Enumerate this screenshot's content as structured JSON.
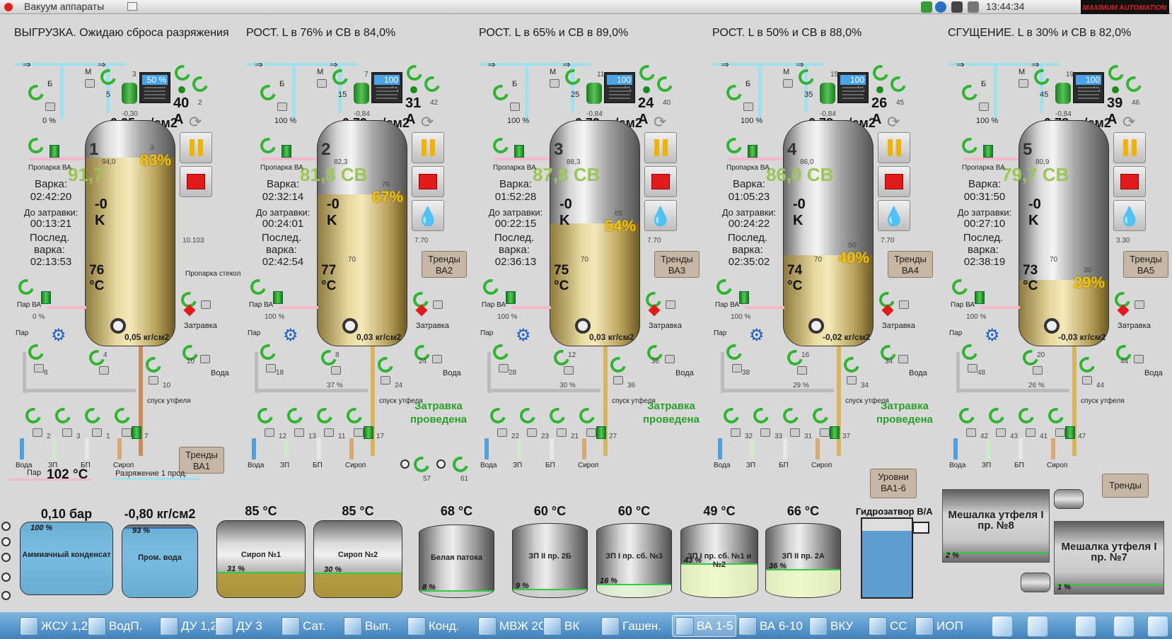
{
  "window": {
    "title": "Вакуум аппараты",
    "clock": "13:44:34",
    "brand": "MAXIMUM AUTOMATION"
  },
  "units": [
    {
      "header": "ВЫГРУЗКА. Ожидаю сброса разряжения",
      "num": "1",
      "monitor_pct": "50 %",
      "monitor_id": "3",
      "amps": "40 A",
      "amps_small": "2",
      "pressure_small": "-0,30",
      "pressure": "-0,35 кг/см2",
      "level_set": "94,0",
      "cb": "91,7",
      "cb_unit": "",
      "level_pct": "83%",
      "level_small": "3",
      "fill": 0.83,
      "varka_label": "Варка:",
      "varka": "02:42:20",
      "k": "-0 K",
      "zatravka_label": "До затравки:",
      "zatravka": "00:13:21",
      "last_label": "Послед. варка:",
      "last": "02:13:53",
      "temp": "76 °C",
      "temp_small": "",
      "bottom_press": "0,05 кг/см2",
      "flow": "",
      "trend": "Тренды ВА1",
      "cond_pct": "0 %",
      "steam_pct": "0 %",
      "small_val": "10.103",
      "valve_a": "4",
      "valve_b": "10",
      "valve_c": "8",
      "valve_d": "2",
      "valve_e": "3",
      "valve_f": "1",
      "valve_g": "7",
      "left_pct": "0 %",
      "extra": "Пропарка стекол",
      "status": "",
      "purge_small": "5",
      "purge_id": "1"
    },
    {
      "header": "РОСТ. L в 76% и СВ в 84,0%",
      "num": "2",
      "monitor_pct": "100 %",
      "monitor_id": "7",
      "amps": "31 A",
      "amps_small": "42",
      "pressure_small": "-0,84",
      "pressure": "-0,79 кг/см2",
      "level_set": "82,3",
      "cb": "81,8",
      "cb_unit": "СВ",
      "level_pct": "67%",
      "level_small": "76",
      "fill": 0.67,
      "varka_label": "Варка:",
      "varka": "02:32:14",
      "k": "-0 K",
      "zatravka_label": "До затравки:",
      "zatravka": "00:24:01",
      "last_label": "Послед. варка:",
      "last": "02:42:54",
      "temp": "77 °C",
      "temp_small": "70",
      "bottom_press": "0,03 кг/см2",
      "flow": "37 %",
      "trend": "Тренды ВА2",
      "cond_pct": "100 %",
      "steam_pct": "100 %",
      "small_val": "7.70",
      "valve_a": "8",
      "valve_b": "24",
      "valve_c": "18",
      "valve_d": "12",
      "valve_e": "13",
      "valve_f": "11",
      "valve_g": "17",
      "left_pct": "100 %",
      "extra": "",
      "status": "Затравка проведена",
      "purge_small": "15",
      "purge_id": "5"
    },
    {
      "header": "РОСТ. L в 65% и СВ в 89,0%",
      "num": "3",
      "monitor_pct": "100 %",
      "monitor_id": "11",
      "amps": "24 A",
      "amps_small": "40",
      "pressure_small": "-0,84",
      "pressure": "-0,79 кг/см2",
      "level_set": "88,3",
      "cb": "87,8",
      "cb_unit": "СВ",
      "level_pct": "54%",
      "level_small": "65",
      "fill": 0.54,
      "varka_label": "Варка:",
      "varka": "01:52:28",
      "k": "-0 K",
      "zatravka_label": "До затравки:",
      "zatravka": "00:22:15",
      "last_label": "Послед. варка:",
      "last": "02:36:13",
      "temp": "75 °C",
      "temp_small": "70",
      "bottom_press": "0,03 кг/см2",
      "flow": "30 %",
      "trend": "Тренды ВА3",
      "cond_pct": "100 %",
      "steam_pct": "100 %",
      "small_val": "7.70",
      "valve_a": "12",
      "valve_b": "36",
      "valve_c": "28",
      "valve_d": "22",
      "valve_e": "23",
      "valve_f": "21",
      "valve_g": "27",
      "left_pct": "100 %",
      "extra": "",
      "status": "Затравка проведена",
      "purge_small": "25",
      "purge_id": "9"
    },
    {
      "header": "РОСТ. L в 50% и СВ в 88,0%",
      "num": "4",
      "monitor_pct": "100 %",
      "monitor_id": "15",
      "amps": "26 A",
      "amps_small": "45",
      "pressure_small": "-0,84",
      "pressure": "-0,78 кг/см2",
      "level_set": "86,0",
      "cb": "86,0",
      "cb_unit": "СВ",
      "level_pct": "40%",
      "level_small": "50",
      "fill": 0.4,
      "varka_label": "Варка:",
      "varka": "01:05:23",
      "k": "-0 K",
      "zatravka_label": "До затравки:",
      "zatravka": "00:24:22",
      "last_label": "Послед. варка:",
      "last": "02:35:02",
      "temp": "74 °C",
      "temp_small": "70",
      "bottom_press": "-0,02 кг/см2",
      "flow": "29 %",
      "trend": "Тренды ВА4",
      "cond_pct": "100 %",
      "steam_pct": "100 %",
      "small_val": "7.70",
      "valve_a": "16",
      "valve_b": "34",
      "valve_c": "38",
      "valve_d": "32",
      "valve_e": "33",
      "valve_f": "31",
      "valve_g": "37",
      "left_pct": "100 %",
      "extra": "",
      "status": "Затравка проведена",
      "purge_small": "35",
      "purge_id": "13"
    },
    {
      "header": "СГУЩЕНИЕ. L в 30% и СВ в 82,0%",
      "num": "5",
      "monitor_pct": "100 %",
      "monitor_id": "19",
      "amps": "39 A",
      "amps_small": "46",
      "pressure_small": "-0,84",
      "pressure": "-0,78 кг/см2",
      "level_set": "80,9",
      "cb": "79,7",
      "cb_unit": "СВ",
      "level_pct": "29%",
      "level_small": "30",
      "fill": 0.29,
      "varka_label": "Варка:",
      "varka": "00:31:50",
      "k": "-0 K",
      "zatravka_label": "До затравки:",
      "zatravka": "00:27:10",
      "last_label": "Послед. варка:",
      "last": "02:38:19",
      "temp": "73 °C",
      "temp_small": "70",
      "bottom_press": "-0,03 кг/см2",
      "flow": "26 %",
      "trend": "Тренды ВА5",
      "cond_pct": "100 %",
      "steam_pct": "100 %",
      "small_val": "3.30",
      "valve_a": "20",
      "valve_b": "44",
      "valve_c": "48",
      "valve_d": "42",
      "valve_e": "43",
      "valve_f": "41",
      "valve_g": "47",
      "left_pct": "100 %",
      "extra": "",
      "status": "",
      "purge_small": "45",
      "purge_id": "17"
    }
  ],
  "labels": {
    "propar": "Пропарка ВА",
    "zatravka": "Затравка",
    "voda": "Вода",
    "par_va": "Пар ВА",
    "par": "Пар",
    "b": "Б",
    "m": "М",
    "p": "Р",
    "outlet": "спуск утфеля",
    "bottom": [
      "Вода",
      "ЗП",
      "БП",
      "Сироп"
    ]
  },
  "bottom": {
    "steam_label": "Пар",
    "steam_temp": "102 °C",
    "vac_label": "Разряжение 1 прод.",
    "valve57": "57",
    "valve61": "61",
    "levels_btn": "Уровни ВА1-6",
    "trends_btn": "Тренды",
    "hydro_label": "Гидрозатвор В/А",
    "vessels": [
      {
        "top": "0,10 бар",
        "name": "Аммиачный конденсат",
        "pct": "100 %",
        "fill": 1.0,
        "color": "#6cb6e0"
      },
      {
        "top": "-0,80 кг/см2",
        "name": "Пром. вода",
        "pct": "93 %",
        "fill": 0.93,
        "color": "#6cb6e0"
      },
      {
        "top": "85 °C",
        "name": "Сироп №1",
        "pct": "31 %",
        "fill": 0.31,
        "color": "#b59a3a"
      },
      {
        "top": "85 °C",
        "name": "Сироп №2",
        "pct": "30 %",
        "fill": 0.3,
        "color": "#b59a3a"
      },
      {
        "top": "68 °C",
        "name": "Белая патока",
        "pct": "8 %",
        "fill": 0.08,
        "color": "#cfcfcf"
      },
      {
        "top": "60 °C",
        "name": "ЗП II пр. 2Б",
        "pct": "9 %",
        "fill": 0.09,
        "color": "#cfcfcf"
      },
      {
        "top": "60 °C",
        "name": "ЗП I пр. сб. №3",
        "pct": "16 %",
        "fill": 0.16,
        "color": "#e5f2d5"
      },
      {
        "top": "49 °C",
        "name": "ЗП I пр. сб. №1 и №2",
        "pct": "43 %",
        "fill": 0.43,
        "color": "#eef7c8"
      },
      {
        "top": "66 °C",
        "name": "ЗП II пр. 2А",
        "pct": "36 %",
        "fill": 0.36,
        "color": "#eef7c8"
      }
    ],
    "mixer8": {
      "name": "Мешалка утфеля I пр. №8",
      "pct": "2 %"
    },
    "mixer7": {
      "name": "Мешалка утфеля I пр. №7",
      "pct": "1 %"
    }
  },
  "taskbar": [
    "ЖСУ 1,2",
    "ВодП.",
    "ДУ 1,2",
    "ДУ 3",
    "Сат.",
    "Вып.",
    "Конд.",
    "МВЖ 2С",
    "ВК",
    "Гашен.",
    "ВА 1-5",
    "ВА 6-10",
    "ВКУ",
    "СС",
    "ИОП"
  ],
  "taskbar_active": "ВА 1-5",
  "colors": {
    "background": "#d8d8d8",
    "accent_green": "#9ac655",
    "level_yellow": "#f1c40f",
    "taskbar": "#4a86c0",
    "stop_red": "#e31a1a"
  }
}
